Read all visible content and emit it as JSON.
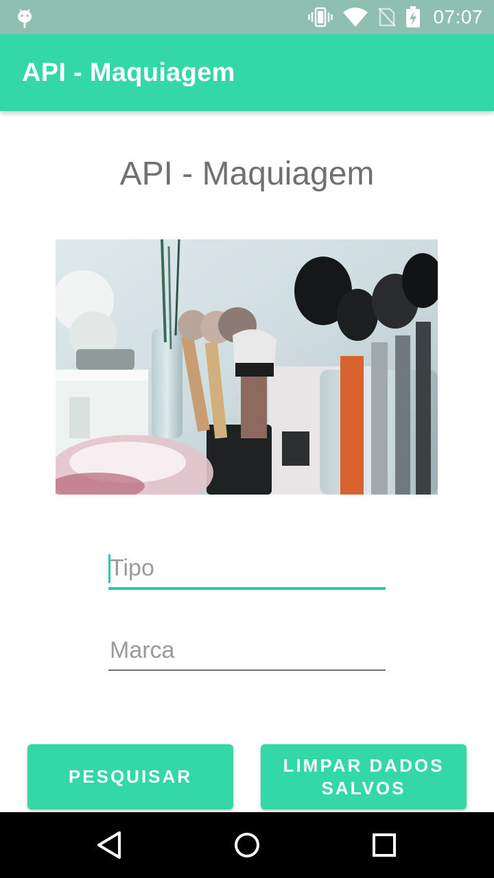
{
  "status_bar": {
    "time": "07:07",
    "icons": [
      "android-icon",
      "vibrate-icon",
      "wifi-icon",
      "no-sim-icon",
      "battery-charging-icon"
    ]
  },
  "app_bar": {
    "title": "API - Maquiagem",
    "color": "#34d7a6"
  },
  "main": {
    "heading": "API - Maquiagem",
    "image": "makeup-brushes-photo",
    "fields": {
      "tipo": {
        "value": "",
        "placeholder": "Tipo"
      },
      "marca": {
        "value": "",
        "placeholder": "Marca"
      }
    },
    "buttons": {
      "pesquisar": "PESQUISAR",
      "limpar": "LIMPAR DADOS SALVOS"
    }
  },
  "nav_bar": {
    "icons": [
      "back-icon",
      "home-icon",
      "recents-icon"
    ]
  }
}
